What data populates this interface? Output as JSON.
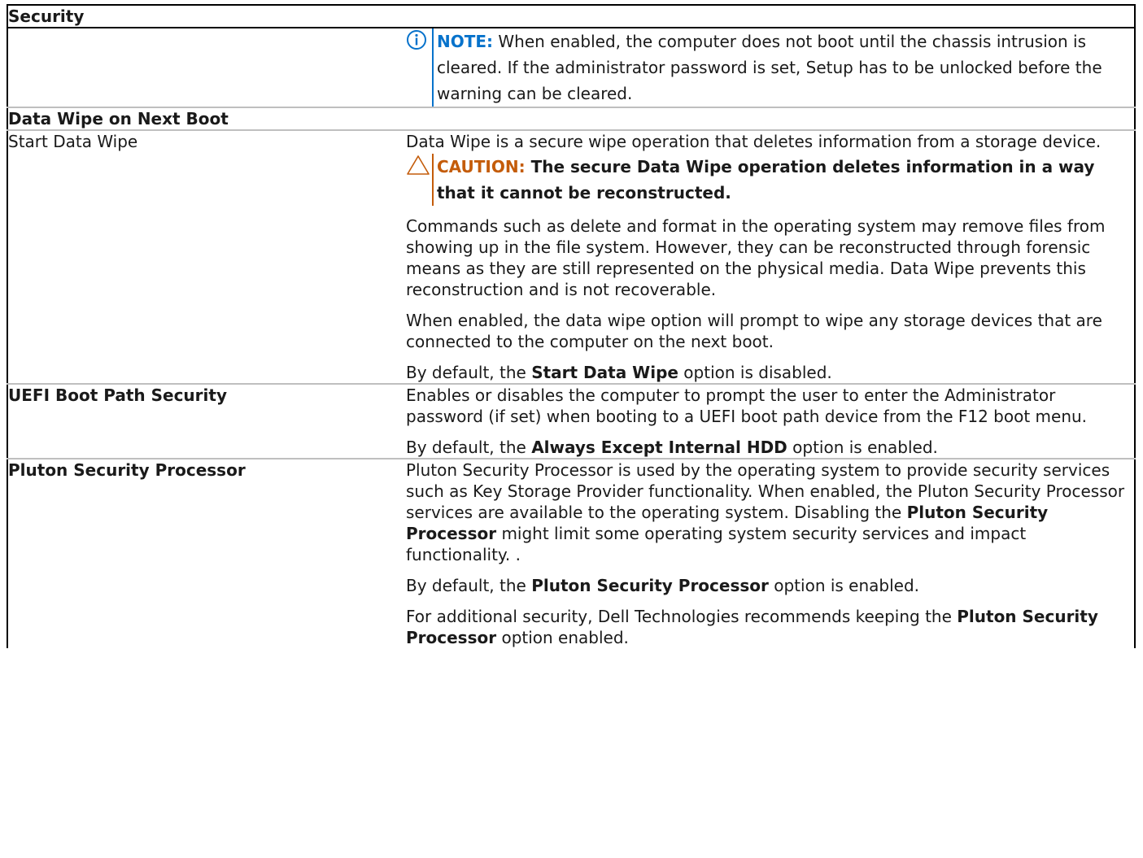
{
  "table_title": "Security",
  "chassis_note": {
    "label": "NOTE:",
    "text": " When enabled, the computer does not boot until the chassis intrusion is cleared. If the administrator password is set, Setup has to be unlocked before the warning can be cleared."
  },
  "section_data_wipe": {
    "title": "Data Wipe on Next Boot",
    "start_data_wipe": {
      "name": "Start Data Wipe",
      "desc1": "Data Wipe is a secure wipe operation that deletes information from a storage device.",
      "caution_label": "CAUTION:",
      "caution_text": " The secure Data Wipe operation deletes information in a way that it cannot be reconstructed.",
      "desc2": "Commands such as delete and format in the operating system may remove files from showing up in the file system. However, they can be reconstructed through forensic means as they are still represented on the physical media. Data Wipe prevents this reconstruction and is not recoverable.",
      "desc3": "When enabled, the data wipe option will prompt to wipe any storage devices that are connected to the computer on the next boot.",
      "default_pre": "By default, the ",
      "default_bold": "Start Data Wipe",
      "default_post": " option is disabled."
    }
  },
  "uefi_boot_path": {
    "name": "UEFI Boot Path Security",
    "desc": "Enables or disables the computer to prompt the user to enter the Administrator password (if set) when booting to a UEFI boot path device from the F12 boot menu.",
    "default_pre": "By default, the ",
    "default_bold": "Always Except Internal HDD",
    "default_post": " option is enabled."
  },
  "pluton": {
    "name": "Pluton Security Processor",
    "desc_pre": "Pluton Security Processor is used by the operating system to provide security services such as Key Storage Provider functionality. When enabled, the Pluton Security Processor services are available to the operating system. Disabling the ",
    "desc_bold": "Pluton Security Processor",
    "desc_post": " might limit some operating system security services and impact functionality. .",
    "default_pre": "By default, the ",
    "default_bold": "Pluton Security Processor",
    "default_post": " option is enabled.",
    "rec_pre": "For additional security, Dell Technologies recommends keeping the ",
    "rec_bold": "Pluton Security Processor",
    "rec_post": " option enabled."
  },
  "icons": {
    "note": "info-circle-icon",
    "caution": "warning-triangle-icon"
  },
  "colors": {
    "note_accent": "#0672cb",
    "caution_accent": "#c45c0a"
  }
}
